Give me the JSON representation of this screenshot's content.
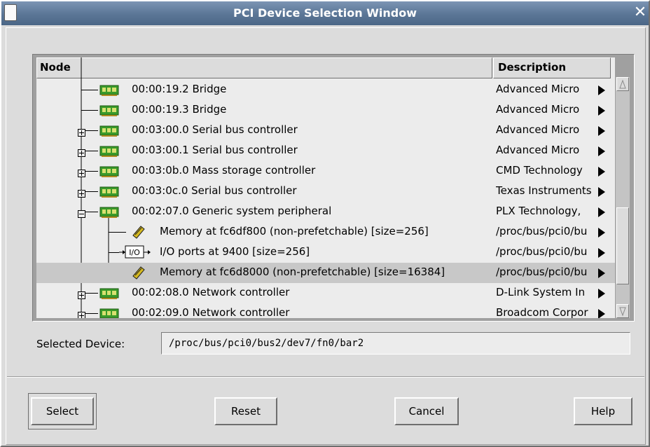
{
  "window": {
    "title": "PCI Device Selection Window"
  },
  "columns": {
    "node": "Node",
    "description": "Description"
  },
  "rows": [
    {
      "label": "00:00:19.2 Bridge",
      "description": "Advanced Micro",
      "kind": "device",
      "level": 1,
      "expander": "none"
    },
    {
      "label": "00:00:19.3 Bridge",
      "description": "Advanced Micro",
      "kind": "device",
      "level": 1,
      "expander": "none"
    },
    {
      "label": "00:03:00.0 Serial bus controller",
      "description": "Advanced Micro",
      "kind": "device",
      "level": 1,
      "expander": "plus"
    },
    {
      "label": "00:03:00.1 Serial bus controller",
      "description": "Advanced Micro",
      "kind": "device",
      "level": 1,
      "expander": "plus"
    },
    {
      "label": "00:03:0b.0 Mass storage controller",
      "description": "CMD Technology",
      "kind": "device",
      "level": 1,
      "expander": "plus"
    },
    {
      "label": "00:03:0c.0 Serial bus controller",
      "description": "Texas Instruments",
      "kind": "device",
      "level": 1,
      "expander": "plus"
    },
    {
      "label": "00:02:07.0 Generic system peripheral",
      "description": "PLX Technology,",
      "kind": "device",
      "level": 1,
      "expander": "minus"
    },
    {
      "label": "Memory at fc6df800 (non-prefetchable) [size=256]",
      "description": "/proc/bus/pci0/bu",
      "kind": "memory",
      "level": 2
    },
    {
      "label": "I/O ports at 9400 [size=256]",
      "description": "/proc/bus/pci0/bu",
      "kind": "io",
      "level": 2
    },
    {
      "label": "Memory at fc6d8000 (non-prefetchable) [size=16384]",
      "description": "/proc/bus/pci0/bu",
      "kind": "memory",
      "level": 2,
      "selected": true
    },
    {
      "label": "00:02:08.0 Network controller",
      "description": "D-Link System In",
      "kind": "device",
      "level": 1,
      "expander": "plus"
    },
    {
      "label": "00:02:09.0 Network controller",
      "description": "Broadcom Corpor",
      "kind": "device",
      "level": 1,
      "expander": "plus"
    }
  ],
  "io_icon_text": "I/O",
  "selected_device": {
    "label": "Selected Device:",
    "value": "/proc/bus/pci0/bus2/dev7/fn0/bar2"
  },
  "buttons": {
    "select": "Select",
    "reset": "Reset",
    "cancel": "Cancel",
    "help": "Help"
  },
  "colors": {
    "titlebar": "#5d7898",
    "background": "#dcdcdc",
    "list_bg": "#ececec",
    "selected_row": "#c8c8c8",
    "chip_green": "#3a9a2a"
  }
}
